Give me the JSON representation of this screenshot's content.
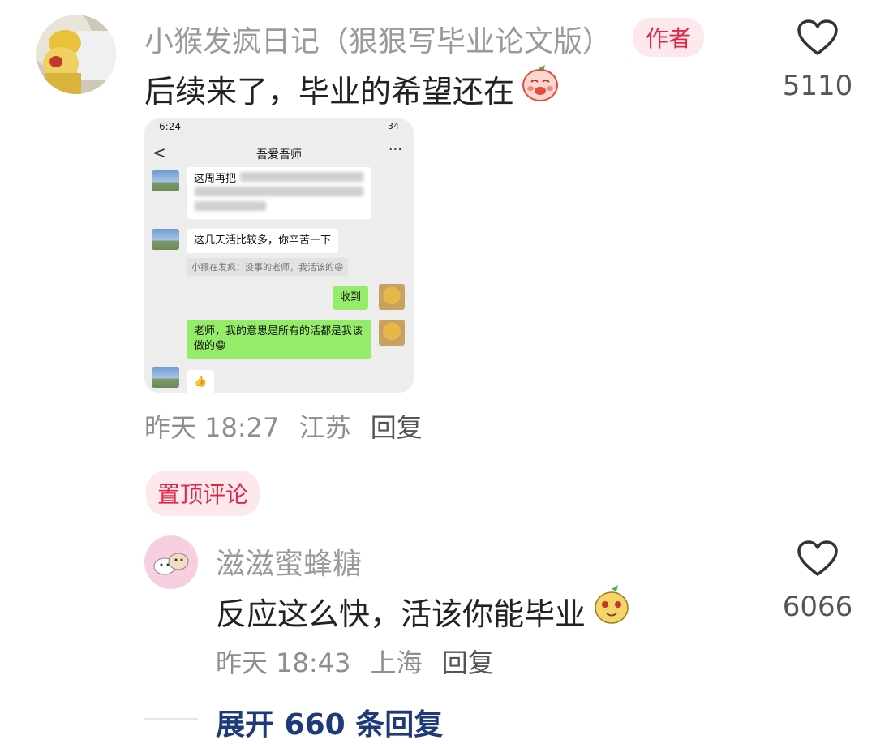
{
  "comment1": {
    "username": "小猴发疯日记（狠狠写毕业论文版）",
    "author_badge": "作者",
    "text": "后续来了，毕业的希望还在",
    "likes": "5110",
    "meta": {
      "time": "昨天 18:27",
      "location": "江苏",
      "reply": "回复"
    },
    "screenshot": {
      "status_time": "6:24",
      "status_right": "34",
      "chat_title": "吾爱吾师",
      "back": "<",
      "more": "···",
      "msg1": "这周再把",
      "msg2": "这几天活比较多，你辛苦一下",
      "quote": "小猴在发疯：没事的老师，我活该的😁",
      "reply1": "收到",
      "reply2": "老师，我的意思是所有的活都是我该做的😁",
      "thumb": "👍"
    }
  },
  "pin_badge": "置顶评论",
  "comment2": {
    "username": "滋滋蜜蜂糖",
    "text": "反应这么快，活该你能毕业",
    "likes": "6066",
    "meta": {
      "time": "昨天 18:43",
      "location": "上海",
      "reply": "回复"
    }
  },
  "expand": "展开 660 条回复",
  "colors": {
    "accent_red": "#e0284a",
    "badge_bg": "#fde8ec",
    "link_blue": "#1f3a7a",
    "wechat_green": "#95ec69"
  },
  "icons": [
    "heart-outline-icon",
    "emoji-sticker-icon"
  ]
}
